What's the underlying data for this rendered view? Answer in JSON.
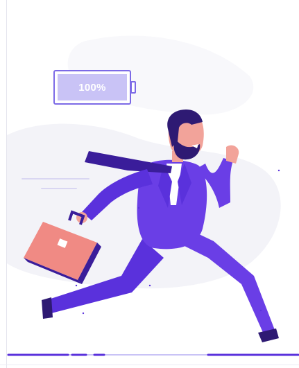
{
  "illustration": {
    "battery": {
      "label": "100%",
      "level": 1.0,
      "icon": "battery-full-icon"
    },
    "subject": "running-businessman",
    "colors": {
      "suit": "#6a3ee6",
      "suit_shadow": "#4c22c4",
      "tie": "#3a1d9a",
      "skin": "#f2a39a",
      "hair": "#2e1a73",
      "briefcase": "#f08a84",
      "briefcase_dark": "#3a1d9a",
      "battery_fill": "#c9c3f6",
      "battery_outline": "#7c6ae6",
      "background_blob": "#f2f2f7"
    }
  }
}
